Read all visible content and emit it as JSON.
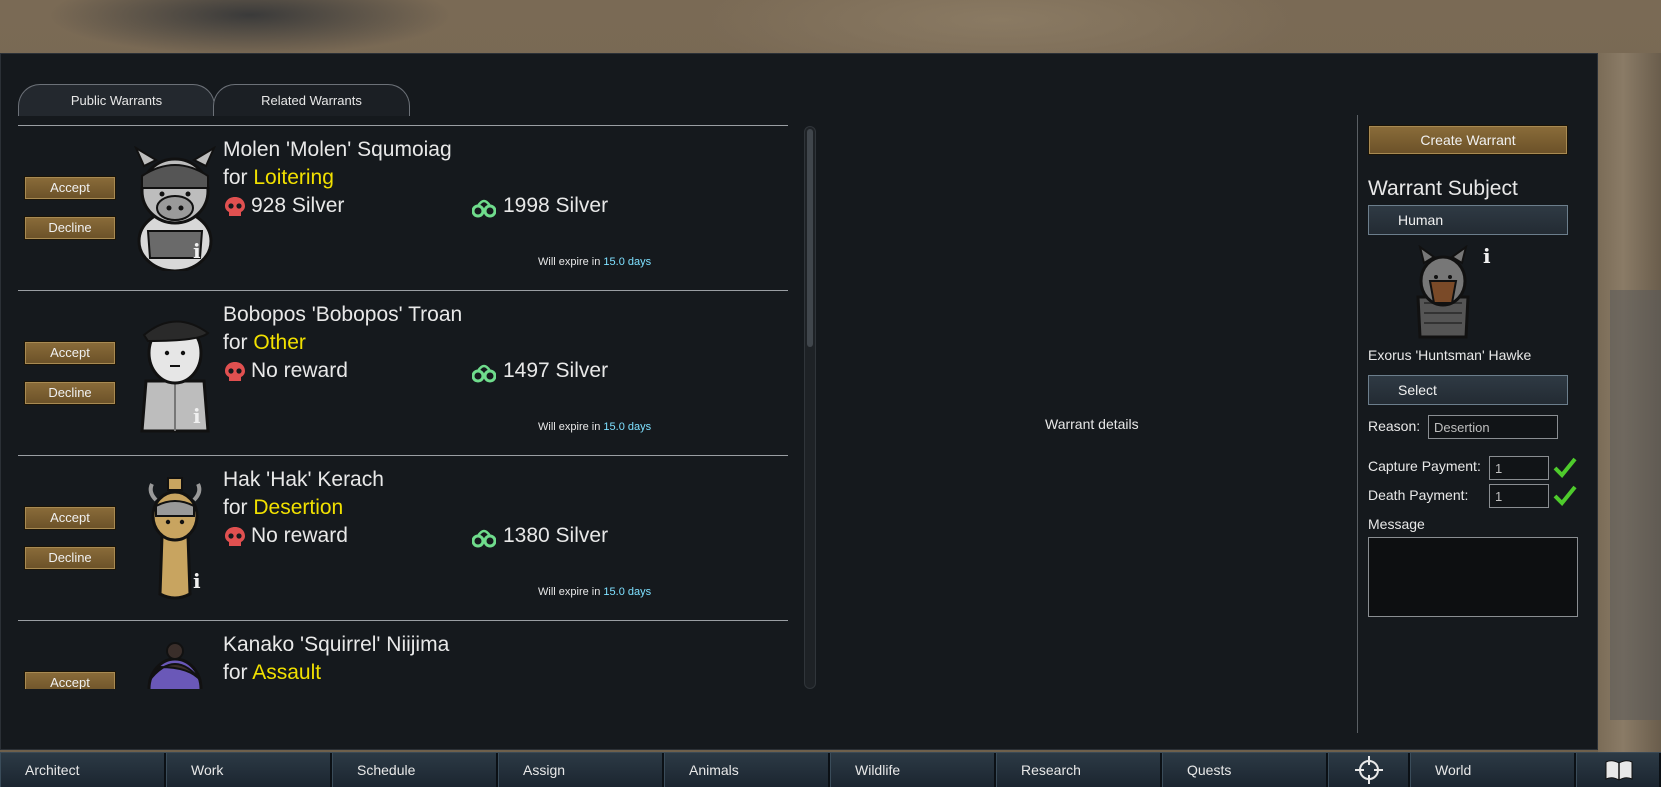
{
  "tabs": [
    {
      "label": "Public Warrants",
      "active": true
    },
    {
      "label": "Related Warrants",
      "active": false
    }
  ],
  "warrants": [
    {
      "name": "Molen 'Molen' Squmoiag",
      "for_label": "for",
      "crime": "Loitering",
      "death_reward": "928 Silver",
      "capture_reward": "1998 Silver",
      "expire_prefix": "Will expire in",
      "expire_days": "15.0 days",
      "accept_label": "Accept",
      "decline_label": "Decline",
      "portrait": "pig-person-portrait"
    },
    {
      "name": "Bobopos 'Bobopos' Troan",
      "for_label": "for",
      "crime": "Other",
      "death_reward": "No reward",
      "capture_reward": "1497 Silver",
      "expire_prefix": "Will expire in",
      "expire_days": "15.0 days",
      "accept_label": "Accept",
      "decline_label": "Decline",
      "portrait": "beret-person-portrait"
    },
    {
      "name": "Hak 'Hak' Kerach",
      "for_label": "for",
      "crime": "Desertion",
      "death_reward": "No reward",
      "capture_reward": "1380 Silver",
      "expire_prefix": "Will expire in",
      "expire_days": "15.0 days",
      "accept_label": "Accept",
      "decline_label": "Decline",
      "portrait": "horned-person-portrait"
    },
    {
      "name": "Kanako 'Squirrel' Niijima",
      "for_label": "for",
      "crime": "Assault",
      "accept_label": "Accept",
      "portrait": "purple-person-portrait"
    }
  ],
  "details_label": "Warrant details",
  "sidebar": {
    "create_label": "Create Warrant",
    "subject_title": "Warrant Subject",
    "subject_type": "Human",
    "subject_name": "Exorus 'Huntsman' Hawke",
    "select_label": "Select",
    "reason_label": "Reason:",
    "reason_value": "Desertion",
    "capture_label": "Capture Payment:",
    "capture_value": "1",
    "death_label": "Death Payment:",
    "death_value": "1",
    "message_label": "Message"
  },
  "bottombar": [
    "Architect",
    "Work",
    "Schedule",
    "Assign",
    "Animals",
    "Wildlife",
    "Research",
    "Quests",
    "",
    "World",
    ""
  ],
  "colors": {
    "crime": "#f1e000",
    "days": "#7ee0ff",
    "skull": "#e05050",
    "cuffs": "#6fdc8c",
    "button": "#7a5e30",
    "check": "#4ecb2c"
  }
}
